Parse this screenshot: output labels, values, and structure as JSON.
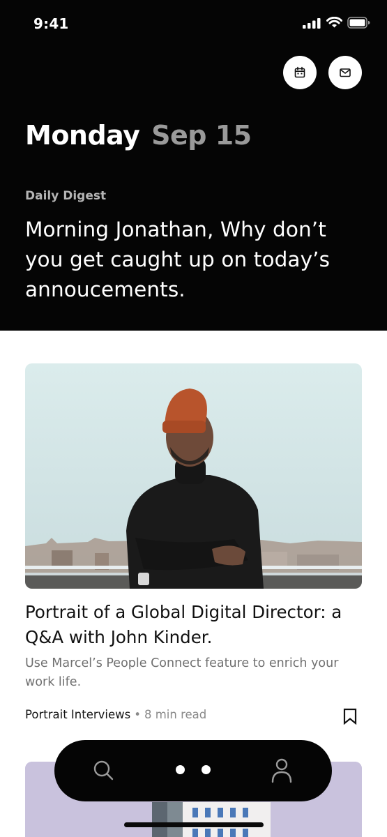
{
  "status_bar": {
    "time": "9:41",
    "icons": [
      "cellular-signal-icon",
      "wifi-icon",
      "battery-icon"
    ]
  },
  "header": {
    "actions": [
      {
        "icon": "calendar-icon"
      },
      {
        "icon": "mail-icon"
      }
    ],
    "day": "Monday",
    "date": "Sep 15",
    "digest_label": "Daily Digest",
    "greeting": "Morning Jonathan, Why don’t you get caught up on today’s annoucements."
  },
  "article": {
    "title": "Portrait of a Global Digital Director: a Q&A with John Kinder.",
    "description": "Use Marcel’s People Connect feature to enrich your work life.",
    "category": "Portrait Interviews",
    "separator": "•",
    "read_time": "8 min read",
    "bookmark_icon": "bookmark-icon"
  },
  "bottom_nav": {
    "items": [
      {
        "icon": "search-icon"
      },
      {
        "icon": "more-dots-icon"
      },
      {
        "icon": "profile-icon"
      }
    ]
  },
  "colors": {
    "header_bg": "#050505",
    "date_gray": "#9a9a9a",
    "next_card_bg": "#c8c1dc"
  }
}
